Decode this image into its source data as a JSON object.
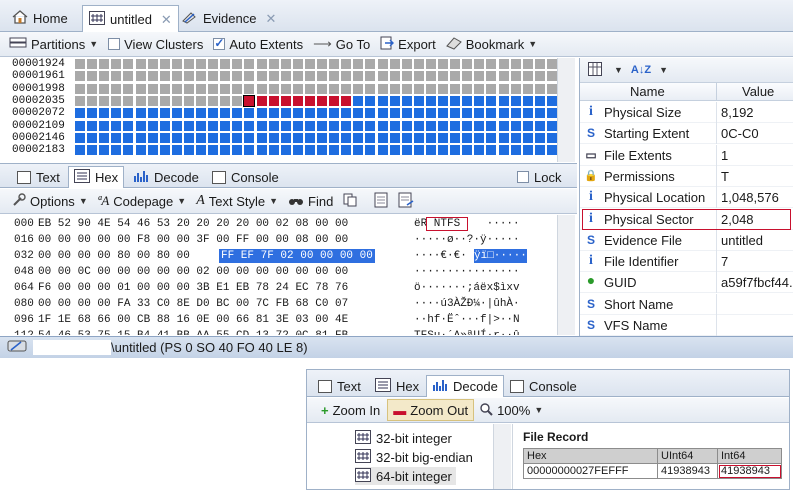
{
  "tabs": [
    {
      "label": "Home",
      "icon": "home-icon"
    },
    {
      "label": "untitled",
      "icon": "grid-icon",
      "closable": true
    },
    {
      "label": "Evidence",
      "icon": "evidence-icon",
      "closable": true
    }
  ],
  "toolbar": {
    "partitions": "Partitions",
    "view_clusters": "View Clusters",
    "auto_extents": "Auto Extents",
    "go_to": "Go To",
    "export": "Export",
    "bookmark": "Bookmark"
  },
  "cluster_addresses": [
    "00001924",
    "00001961",
    "00001998",
    "00002035",
    "00002072",
    "00002109",
    "00002146",
    "00002183"
  ],
  "cluster_colors": {
    "used": "#a9a9a9",
    "allocated": "#1e6de0",
    "selected": "#c8102e"
  },
  "subtabs": {
    "text": "Text",
    "hex": "Hex",
    "decode": "Decode",
    "console": "Console",
    "lock": "Lock"
  },
  "hex_toolbar": {
    "options": "Options",
    "codepage": "Codepage",
    "text_style": "Text Style",
    "find": "Find"
  },
  "hex_rows": [
    {
      "offset": "000",
      "bytes": "EB 52 90 4E 54 46 53 20 20 20 20 00 02 08 00 00",
      "text": "ëR NTFS    ·····"
    },
    {
      "offset": "016",
      "bytes": "00 00 00 00 00 F8 00 00 3F 00 FF 00 00 08 00 00",
      "text": "·····ø··?·ÿ·····"
    },
    {
      "offset": "032",
      "bytes": "00 00 00 00 80 00 80 00",
      "sel": "FF EF 7F 02 00 00 00 00",
      "text": "····€·€·",
      "seltext": "ÿï□·····"
    },
    {
      "offset": "048",
      "bytes": "00 00 0C 00 00 00 00 00 02 00 00 00 00 00 00 00",
      "text": "················"
    },
    {
      "offset": "064",
      "bytes": "F6 00 00 00 01 00 00 00 3B E1 EB 78 24 EC 78 76",
      "text": "ö·······;áëx$ìxv"
    },
    {
      "offset": "080",
      "bytes": "00 00 00 00 FA 33 C0 8E D0 BC 00 7C FB 68 C0 07",
      "text": "····ú3ÀŽÐ¼·|ûhÀ·"
    },
    {
      "offset": "096",
      "bytes": "1F 1E 68 66 00 CB 88 16 0E 00 66 81 3E 03 00 4E",
      "text": "··hf·Ëˆ···f|>··N"
    },
    {
      "offset": "112",
      "bytes": "54 46 53 75 15 B4 41 BB AA 55 CD 13 72 0C 81 FB",
      "text": "TFSu·´A»ªUÍ·r··û"
    }
  ],
  "status": {
    "path": "\\untitled (PS 0 SO 40 FO 40 LE 8)"
  },
  "properties": {
    "header": {
      "name": "Name",
      "value": "Value"
    },
    "rows": [
      {
        "icon": "info-icon",
        "glyph": "i",
        "name": "Physical Size",
        "value": "8,192"
      },
      {
        "icon": "s-icon",
        "glyph": "S",
        "name": "Starting Extent",
        "value": "0C-C0"
      },
      {
        "icon": "extents-icon",
        "glyph": "▭",
        "name": "File Extents",
        "value": "1"
      },
      {
        "icon": "lock-icon",
        "glyph": "🔒",
        "name": "Permissions",
        "value": "T"
      },
      {
        "icon": "info-icon",
        "glyph": "i",
        "name": "Physical Location",
        "value": "1,048,576"
      },
      {
        "icon": "info-icon",
        "glyph": "i",
        "name": "Physical Sector",
        "value": "2,048",
        "highlight": true
      },
      {
        "icon": "s-icon",
        "glyph": "S",
        "name": "Evidence File",
        "value": "untitled"
      },
      {
        "icon": "info-icon",
        "glyph": "i",
        "name": "File Identifier",
        "value": "7"
      },
      {
        "icon": "globe-icon",
        "glyph": "●",
        "name": "GUID",
        "value": "a59f7fbcf44."
      },
      {
        "icon": "s-icon",
        "glyph": "S",
        "name": "Short Name",
        "value": ""
      },
      {
        "icon": "s-icon",
        "glyph": "S",
        "name": "VFS Name",
        "value": ""
      }
    ]
  },
  "inset": {
    "tabs": {
      "text": "Text",
      "hex": "Hex",
      "decode": "Decode",
      "console": "Console"
    },
    "toolbar": {
      "zoom_in": "Zoom In",
      "zoom_out": "Zoom Out",
      "zoom_level": "100%"
    },
    "tree": [
      "32-bit integer",
      "32-bit big-endian",
      "64-bit integer"
    ],
    "record_title": "File Record",
    "columns": [
      "Hex",
      "UInt64",
      "Int64"
    ],
    "row": [
      "00000000027FEFFF",
      "41938943",
      "41938943"
    ]
  }
}
